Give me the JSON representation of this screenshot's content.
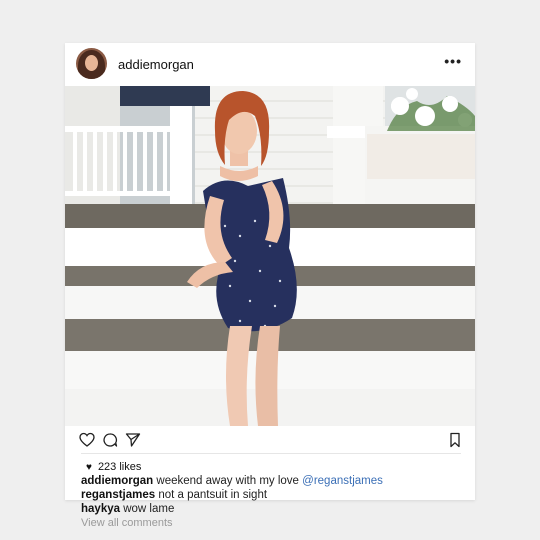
{
  "post": {
    "username": "addiemorgan",
    "more_label": "•••",
    "likes_label": "223 likes",
    "heart_glyph": "♥",
    "comments": [
      {
        "user": "addiemorgan",
        "text": " weekend away with my love ",
        "mention": "@reganstjames"
      },
      {
        "user": "reganstjames",
        "text": " not a pantsuit in sight",
        "mention": ""
      },
      {
        "user": "haykya",
        "text": " wow lame",
        "mention": ""
      }
    ],
    "view_all_label": "View all comments"
  },
  "icons": {
    "like": "heart-outline-icon",
    "comment": "speech-bubble-icon",
    "share": "paper-plane-icon",
    "save": "bookmark-icon"
  },
  "colors": {
    "mention": "#3b6fb6",
    "background": "#efefef"
  }
}
